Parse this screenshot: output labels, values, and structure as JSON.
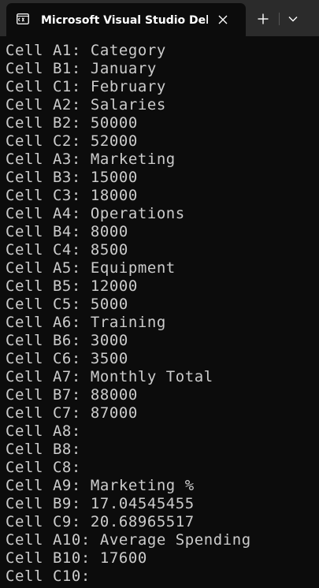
{
  "tab": {
    "title": "Microsoft Visual Studio Debug Console",
    "icon": "terminal-icon"
  },
  "icons": {
    "close": "close-icon",
    "new_tab": "plus-icon",
    "dropdown": "chevron-down-icon"
  },
  "colors": {
    "titlebar_bg": "#2b2b2b",
    "console_bg": "#0c0c0c",
    "console_text": "#cccccc",
    "title_text": "#ffffff"
  },
  "console": {
    "lines": [
      "Cell A1: Category",
      "Cell B1: January",
      "Cell C1: February",
      "Cell A2: Salaries",
      "Cell B2: 50000",
      "Cell C2: 52000",
      "Cell A3: Marketing",
      "Cell B3: 15000",
      "Cell C3: 18000",
      "Cell A4: Operations",
      "Cell B4: 8000",
      "Cell C4: 8500",
      "Cell A5: Equipment",
      "Cell B5: 12000",
      "Cell C5: 5000",
      "Cell A6: Training",
      "Cell B6: 3000",
      "Cell C6: 3500",
      "Cell A7: Monthly Total",
      "Cell B7: 88000",
      "Cell C7: 87000",
      "Cell A8:",
      "Cell B8:",
      "Cell C8:",
      "Cell A9: Marketing %",
      "Cell B9: 17.04545455",
      "Cell C9: 20.68965517",
      "Cell A10: Average Spending",
      "Cell B10: 17600",
      "Cell C10:"
    ]
  }
}
